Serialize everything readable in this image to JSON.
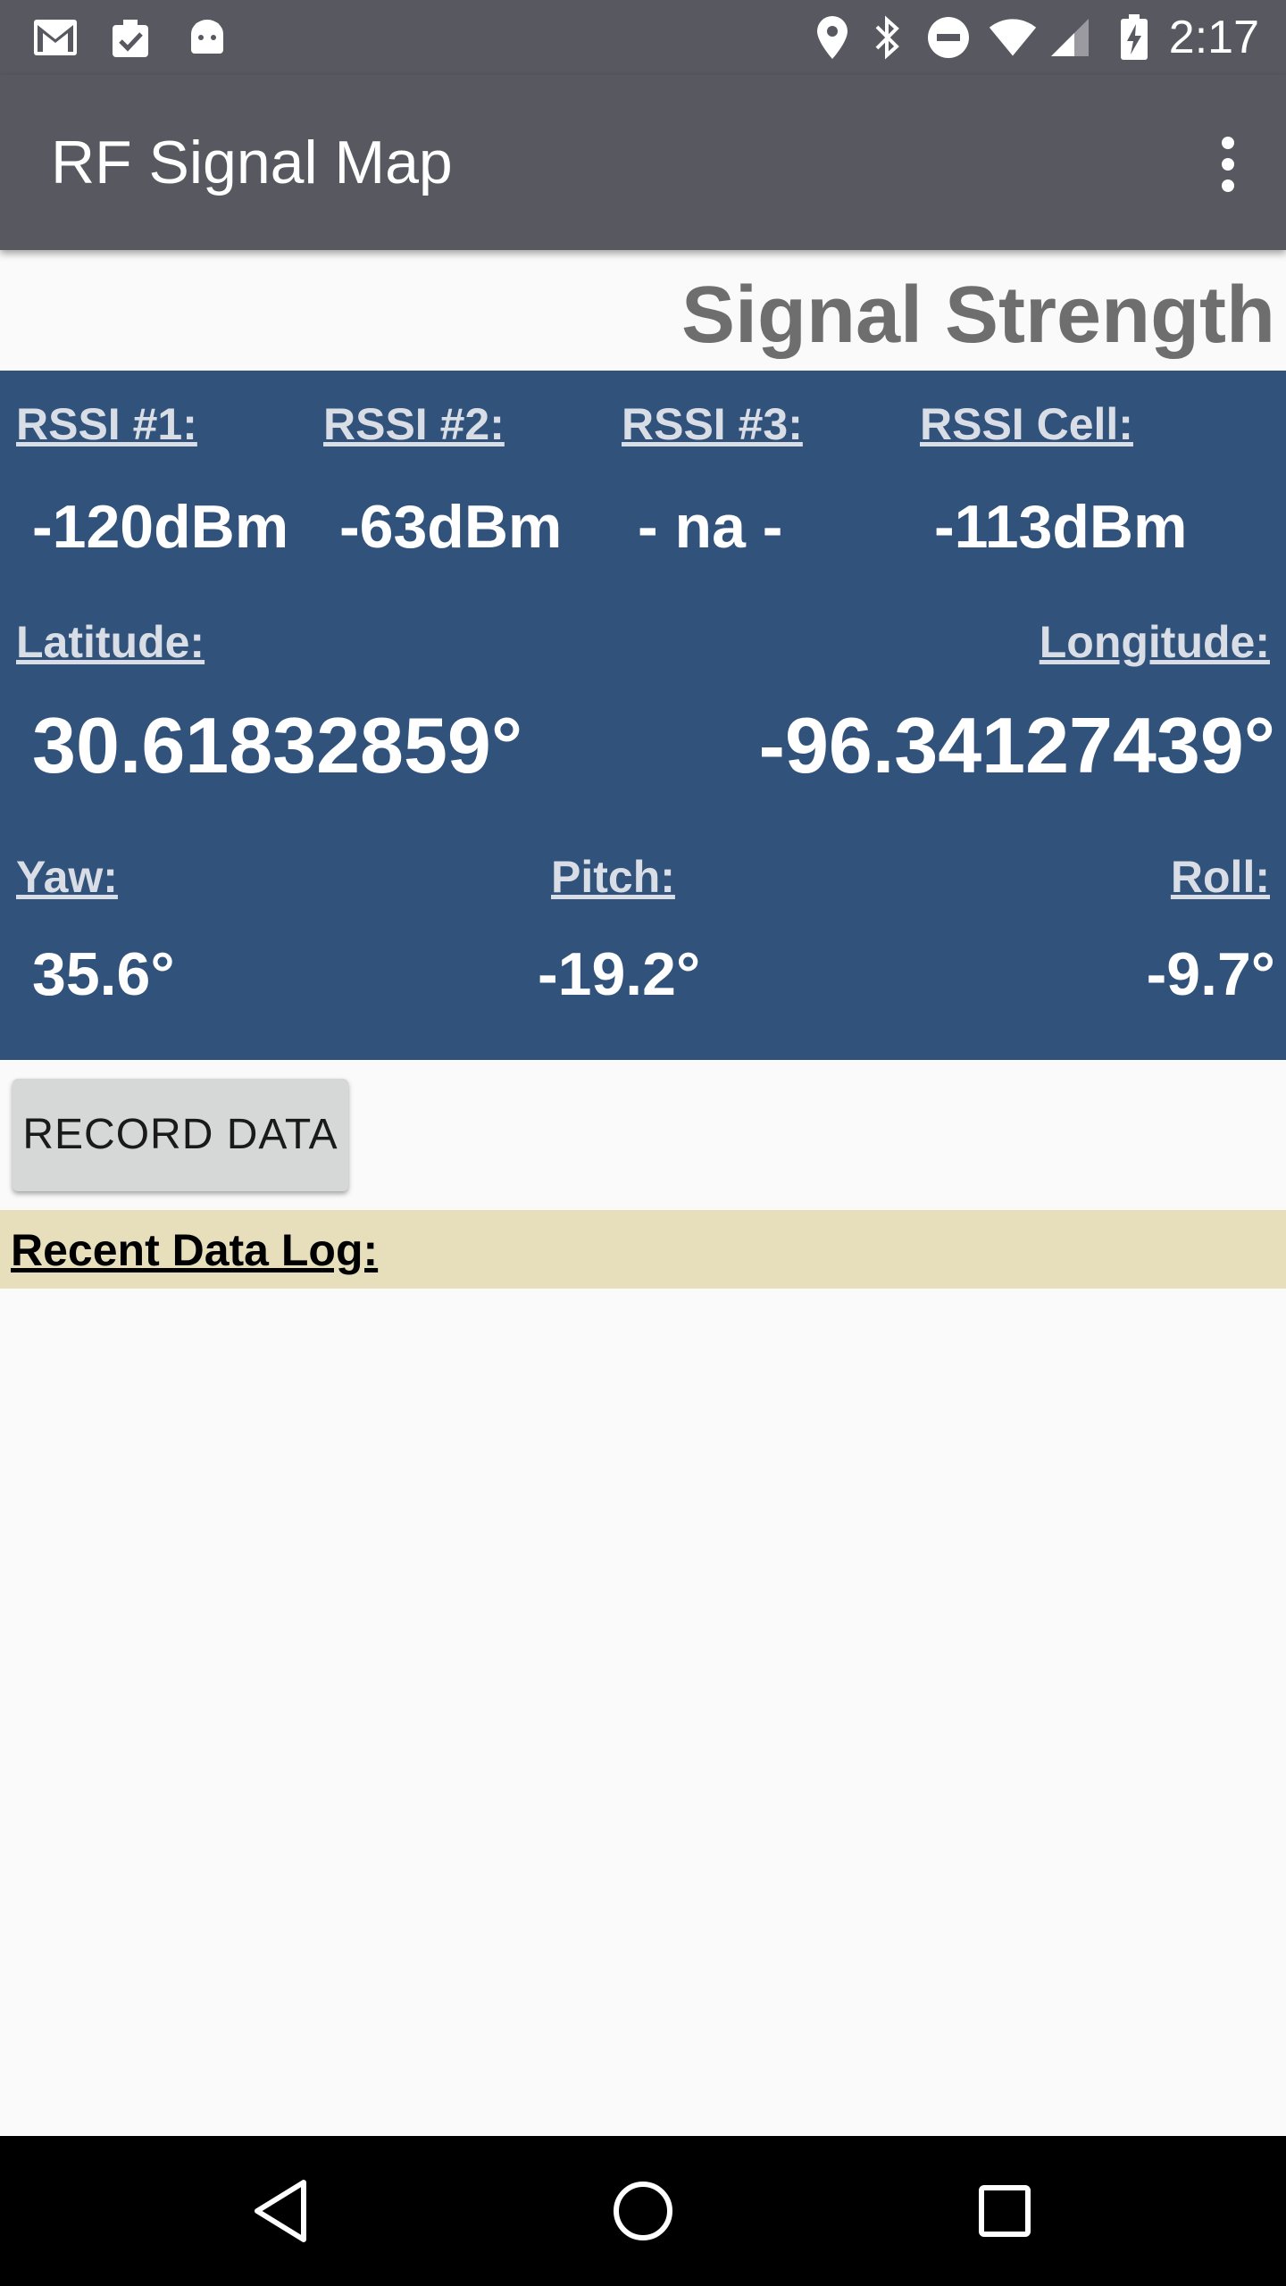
{
  "status_bar": {
    "time": "2:17",
    "left_icons": [
      "gmail-icon",
      "clipboard-check-icon",
      "android-icon"
    ],
    "right_icons": [
      "location-icon",
      "bluetooth-icon",
      "do-not-disturb-icon",
      "wifi-icon",
      "cell-signal-icon",
      "battery-charging-icon"
    ]
  },
  "app_bar": {
    "title": "RF Signal Map",
    "menu_icon": "overflow-menu-icon"
  },
  "section": {
    "title": "Signal Strength"
  },
  "rssi": {
    "r1_label": "RSSI #1:",
    "r1_value": "-120dBm",
    "r2_label": "RSSI #2:",
    "r2_value": "-63dBm",
    "r3_label": "RSSI #3:",
    "r3_value": "- na -",
    "cell_label": "RSSI Cell:",
    "cell_value": "-113dBm"
  },
  "position": {
    "lat_label": "Latitude:",
    "lat_value": "30.61832859°",
    "lon_label": "Longitude:",
    "lon_value": "-96.34127439°"
  },
  "orientation": {
    "yaw_label": "Yaw:",
    "yaw_value": "35.6°",
    "pitch_label": "Pitch:",
    "pitch_value": "-19.2°",
    "roll_label": "Roll:",
    "roll_value": "-9.7°"
  },
  "actions": {
    "record_label": "RECORD DATA"
  },
  "log": {
    "title": "Recent Data Log:"
  },
  "nav_bar": {
    "icons": [
      "back-icon",
      "home-icon",
      "recents-icon"
    ]
  },
  "colors": {
    "app_bar": "#585860",
    "panel": "#31527a",
    "log_header": "#e7dfbc",
    "title_gray": "#6e6e6e"
  }
}
